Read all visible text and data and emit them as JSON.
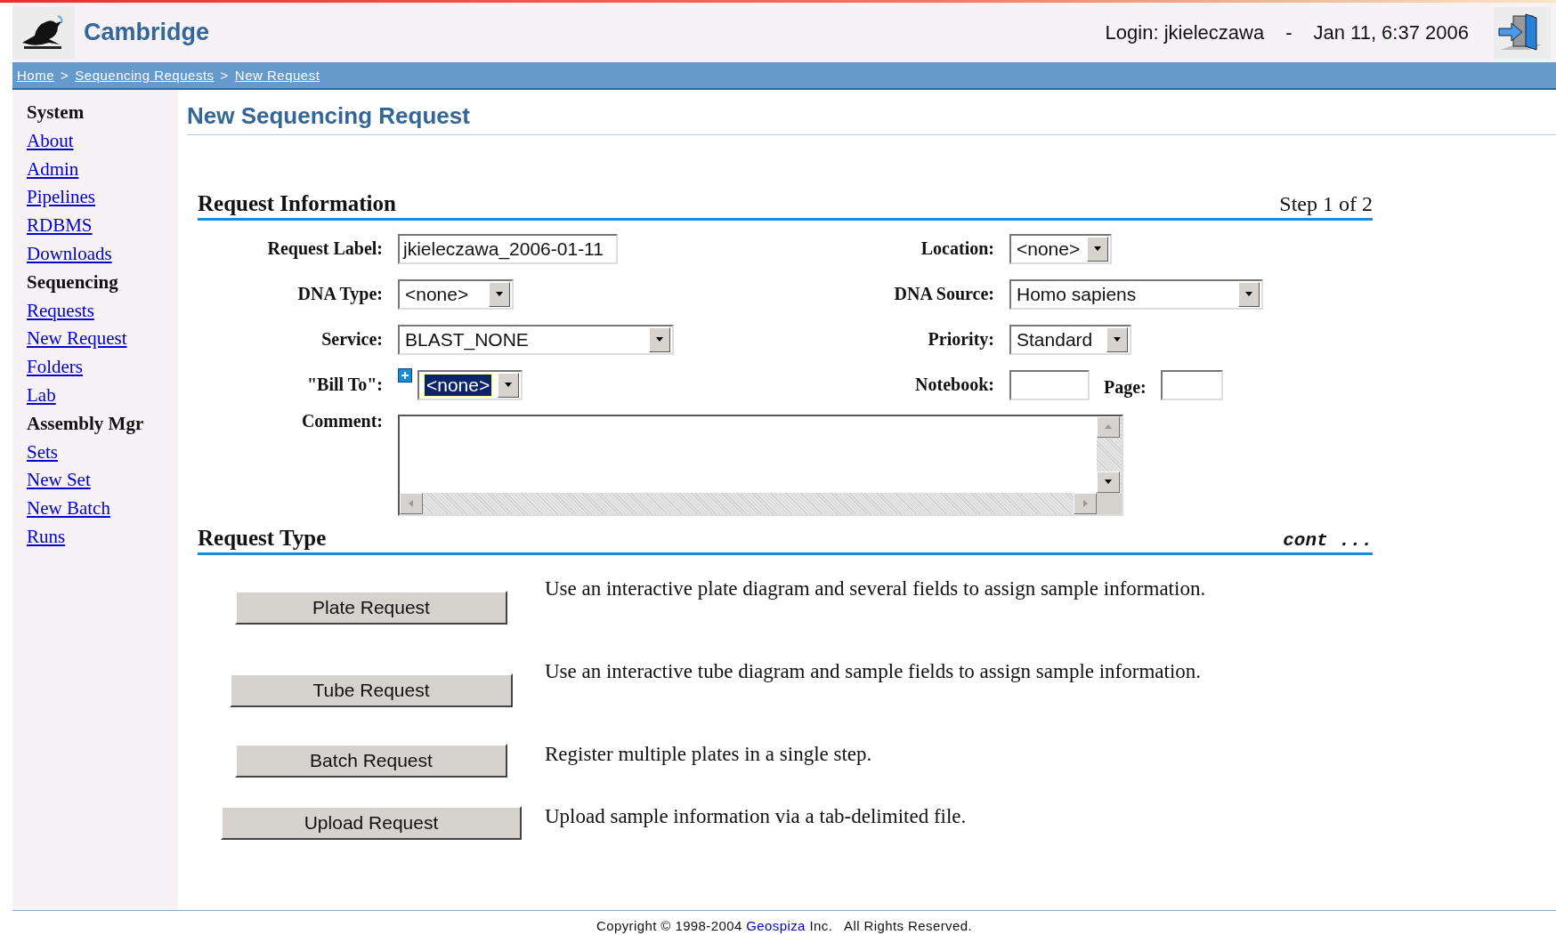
{
  "header": {
    "app_name": "Cambridge",
    "login": "Login: jkieleczawa",
    "separator": "-",
    "date": "Jan 11, 6:37 2006"
  },
  "breadcrumb": [
    {
      "kind": "link",
      "label": "Home"
    },
    {
      "kind": "sep",
      "label": ">"
    },
    {
      "kind": "link",
      "label": "Sequencing Requests"
    },
    {
      "kind": "sep",
      "label": ">"
    },
    {
      "kind": "link",
      "label": "New Request"
    }
  ],
  "sidebar": [
    {
      "heading": "System",
      "items": [
        {
          "label": "About"
        },
        {
          "label": "Admin"
        },
        {
          "label": "Pipelines"
        },
        {
          "label": "RDBMS"
        },
        {
          "label": "Downloads"
        }
      ]
    },
    {
      "heading": "Sequencing",
      "items": [
        {
          "label": "Requests"
        },
        {
          "label": "New Request"
        },
        {
          "label": "Folders"
        },
        {
          "label": "Lab"
        }
      ]
    },
    {
      "heading": "Assembly Mgr",
      "items": [
        {
          "label": "Sets"
        },
        {
          "label": "New Set"
        },
        {
          "label": "New Batch"
        },
        {
          "label": "Runs"
        }
      ]
    }
  ],
  "page_title": "New Sequencing Request",
  "request_information": {
    "title": "Request Information",
    "step": "Step 1 of 2",
    "rows": [
      {
        "left": {
          "label": "Request Label:",
          "kind": "text",
          "value": "jkieleczawa_2006-01-11"
        },
        "right": {
          "label": "Location:",
          "kind": "select",
          "value": "<none>"
        }
      },
      {
        "left": {
          "label": "DNA Type:",
          "kind": "select",
          "value": "<none>"
        },
        "right": {
          "label": "DNA Source:",
          "kind": "select",
          "value": "Homo sapiens"
        }
      },
      {
        "left": {
          "label": "Service:",
          "kind": "select",
          "value": "BLAST_NONE"
        },
        "right": {
          "label": "Priority:",
          "kind": "select",
          "value": "Standard"
        }
      },
      {
        "left": {
          "label": "\"Bill To\":",
          "kind": "select",
          "value": "<none>",
          "highlighted": true,
          "add_button": true
        },
        "right": {
          "label": "Notebook:",
          "kind": "text",
          "extra": {
            "label": "Page:",
            "kind": "text"
          }
        }
      },
      {
        "left": {
          "label": "Comment:",
          "kind": "textarea"
        }
      }
    ]
  },
  "request_type": {
    "title": "Request Type",
    "note": "cont ...",
    "options": [
      {
        "button": "Plate Request",
        "description": "Use an interactive plate diagram and several fields to assign sample information."
      },
      {
        "button": "Tube Request",
        "description": "Use an interactive tube diagram and sample fields to assign sample information."
      },
      {
        "button": "Batch Request",
        "description": "Register multiple plates in a single step."
      },
      {
        "button": "Upload Request",
        "description": "Upload sample information via a tab-delimited file."
      }
    ]
  },
  "footer": {
    "before": "Copyright © 1998-2004",
    "link": "Geospiza",
    "after": "Inc.   All Rights Reserved."
  }
}
